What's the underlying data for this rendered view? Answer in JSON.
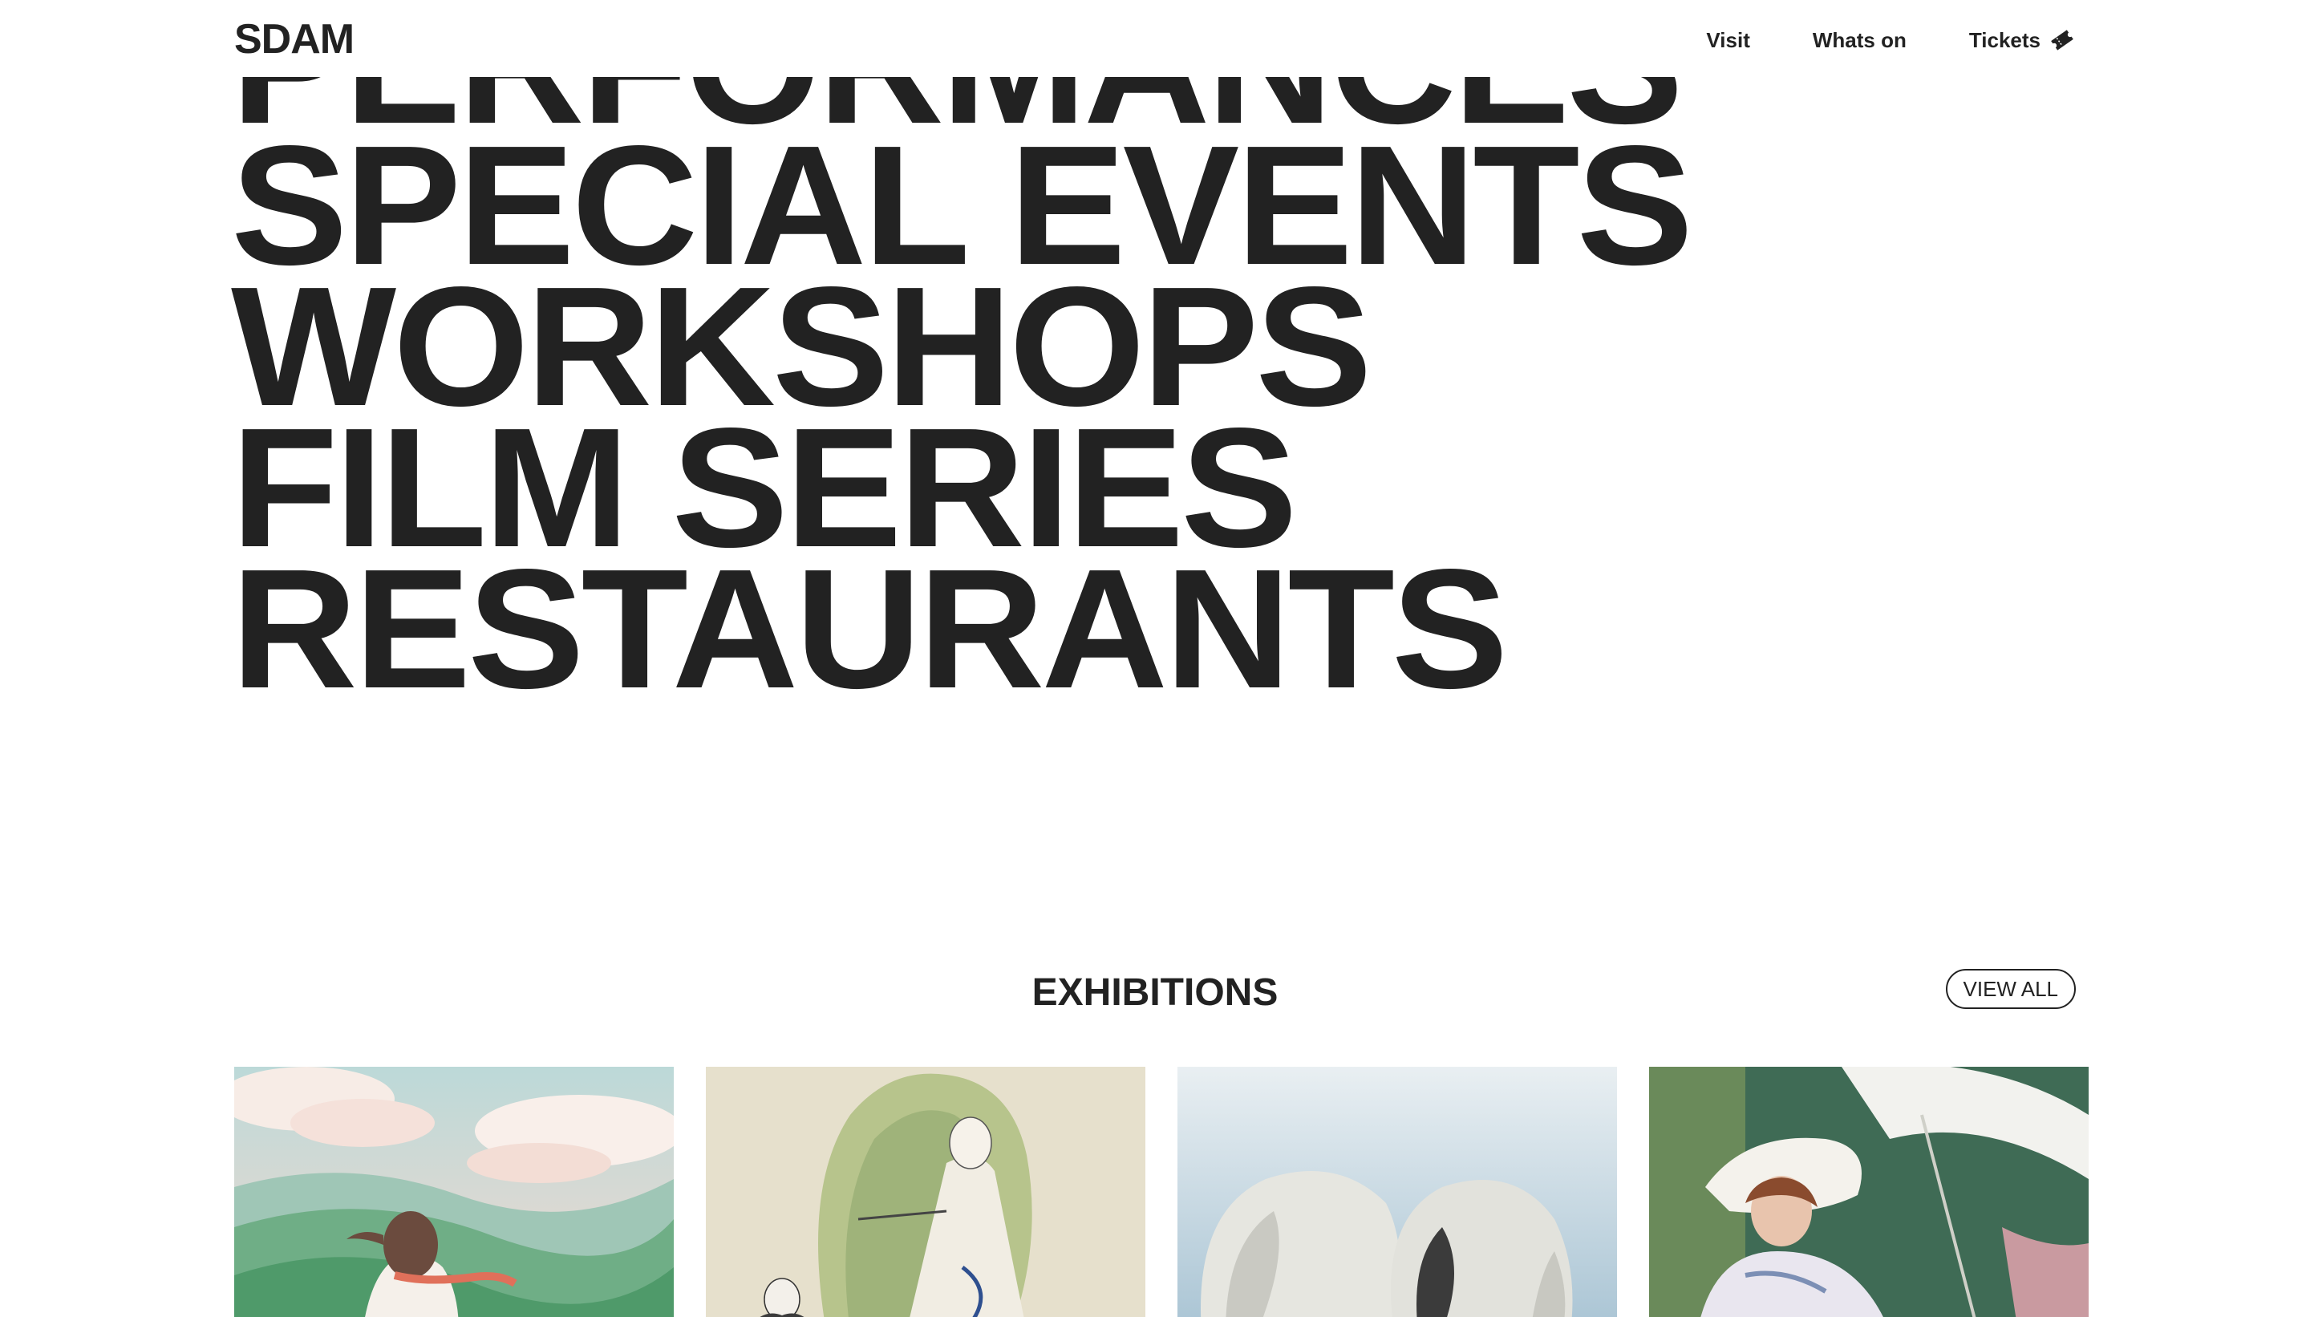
{
  "header": {
    "logo": "SDAM",
    "nav": [
      {
        "label": "Visit"
      },
      {
        "label": "Whats on"
      },
      {
        "label": "Tickets",
        "icon": "ticket-icon"
      }
    ]
  },
  "hero": {
    "words": [
      "PERFORMANCES",
      "SPECIAL EVENTS",
      "WORKSHOPS",
      "FILM SERIES",
      "RESTAURANTS"
    ]
  },
  "exhibitions": {
    "title": "EXHIBITIONS",
    "view_all": "VIEW ALL",
    "cards": [
      {
        "image": "anime-landscape-girl"
      },
      {
        "image": "art-nouveau-illustration"
      },
      {
        "image": "surreal-veiled-figures"
      },
      {
        "image": "watercolor-woman-parasol"
      }
    ]
  },
  "colors": {
    "text": "#222222",
    "background": "#ffffff"
  }
}
